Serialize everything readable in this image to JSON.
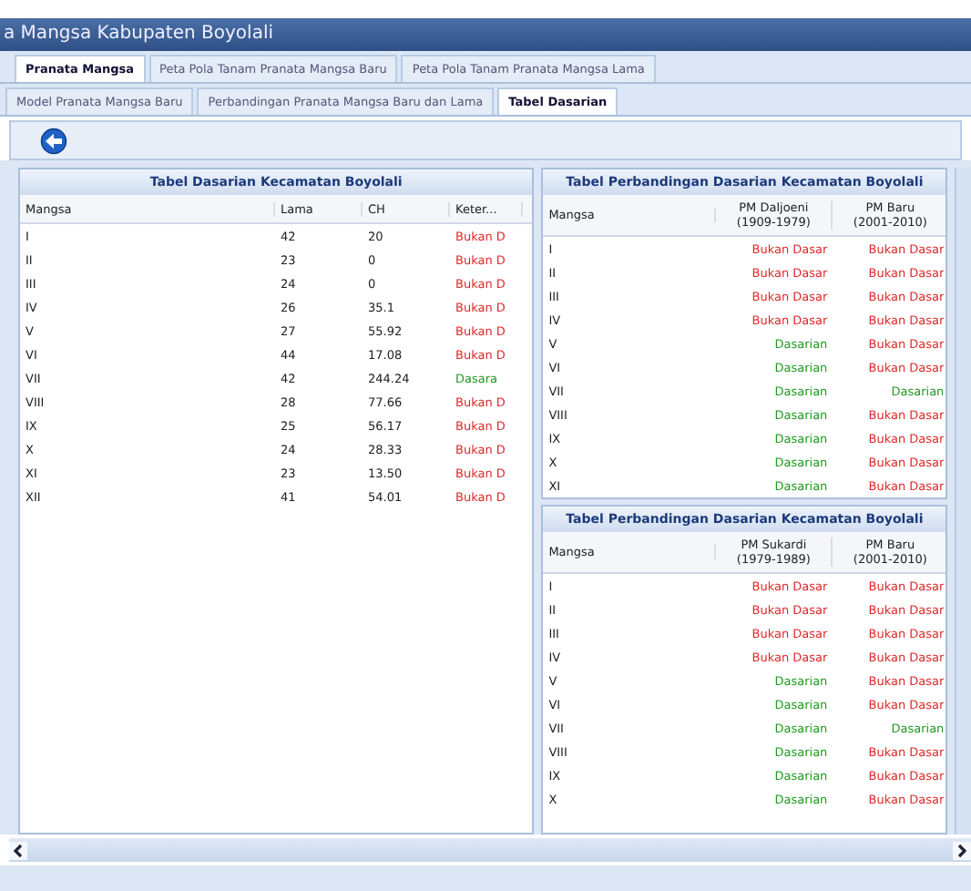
{
  "window": {
    "title": "a Mangsa Kabupaten Boyolali"
  },
  "tabs": [
    {
      "label": "Pranata Mangsa",
      "selected": true
    },
    {
      "label": "Peta Pola Tanam Pranata Mangsa Baru",
      "selected": false
    },
    {
      "label": "Peta Pola Tanam Pranata Mangsa Lama",
      "selected": false
    }
  ],
  "subtabs": [
    {
      "label": "Model Pranata Mangsa Baru",
      "selected": false
    },
    {
      "label": "Perbandingan Pranata Mangsa Baru dan Lama",
      "selected": false
    },
    {
      "label": "Tabel Dasarian",
      "selected": true
    }
  ],
  "left_table": {
    "title": "Tabel Dasarian Kecamatan Boyolali",
    "columns": [
      "Mangsa",
      "Lama",
      "CH",
      "Keter..."
    ],
    "rows": [
      {
        "cells": [
          "I",
          "42",
          "20"
        ],
        "status": {
          "text": "Bukan D",
          "color": "#e02828"
        }
      },
      {
        "cells": [
          "II",
          "23",
          "0"
        ],
        "status": {
          "text": "Bukan D",
          "color": "#e02828"
        }
      },
      {
        "cells": [
          "III",
          "24",
          "0"
        ],
        "status": {
          "text": "Bukan D",
          "color": "#e02828"
        }
      },
      {
        "cells": [
          "IV",
          "26",
          "35.1"
        ],
        "status": {
          "text": "Bukan D",
          "color": "#e02828"
        }
      },
      {
        "cells": [
          "V",
          "27",
          "55.92"
        ],
        "status": {
          "text": "Bukan D",
          "color": "#e02828"
        }
      },
      {
        "cells": [
          "VI",
          "44",
          "17.08"
        ],
        "status": {
          "text": "Bukan D",
          "color": "#e02828"
        }
      },
      {
        "cells": [
          "VII",
          "42",
          "244.24"
        ],
        "status": {
          "text": "Dasara",
          "color": "#229922"
        }
      },
      {
        "cells": [
          "VIII",
          "28",
          "77.66"
        ],
        "status": {
          "text": "Bukan D",
          "color": "#e02828"
        }
      },
      {
        "cells": [
          "IX",
          "25",
          "56.17"
        ],
        "status": {
          "text": "Bukan D",
          "color": "#e02828"
        }
      },
      {
        "cells": [
          "X",
          "24",
          "28.33"
        ],
        "status": {
          "text": "Bukan D",
          "color": "#e02828"
        }
      },
      {
        "cells": [
          "XI",
          "23",
          "13.50"
        ],
        "status": {
          "text": "Bukan D",
          "color": "#e02828"
        }
      },
      {
        "cells": [
          "XII",
          "41",
          "54.01"
        ],
        "status": {
          "text": "Bukan D",
          "color": "#e02828"
        }
      }
    ]
  },
  "compare_tables": [
    {
      "title": "Tabel Perbandingan Dasarian Kecamatan Boyolali",
      "columns": [
        "Mangsa",
        "PM Daljoeni (1909-1979)",
        "PM Baru (2001-2010)"
      ],
      "rows": [
        {
          "mangsa": "I",
          "values": [
            {
              "text": "Bukan Dasar",
              "color": "#e02828"
            },
            {
              "text": "Bukan Dasar",
              "color": "#e02828"
            }
          ]
        },
        {
          "mangsa": "II",
          "values": [
            {
              "text": "Bukan Dasar",
              "color": "#e02828"
            },
            {
              "text": "Bukan Dasar",
              "color": "#e02828"
            }
          ]
        },
        {
          "mangsa": "III",
          "values": [
            {
              "text": "Bukan Dasar",
              "color": "#e02828"
            },
            {
              "text": "Bukan Dasar",
              "color": "#e02828"
            }
          ]
        },
        {
          "mangsa": "IV",
          "values": [
            {
              "text": "Bukan Dasar",
              "color": "#e02828"
            },
            {
              "text": "Bukan Dasar",
              "color": "#e02828"
            }
          ]
        },
        {
          "mangsa": "V",
          "values": [
            {
              "text": "Dasarian",
              "color": "#229922"
            },
            {
              "text": "Bukan Dasar",
              "color": "#e02828"
            }
          ]
        },
        {
          "mangsa": "VI",
          "values": [
            {
              "text": "Dasarian",
              "color": "#229922"
            },
            {
              "text": "Bukan Dasar",
              "color": "#e02828"
            }
          ]
        },
        {
          "mangsa": "VII",
          "values": [
            {
              "text": "Dasarian",
              "color": "#229922"
            },
            {
              "text": "Dasarian",
              "color": "#229922"
            }
          ]
        },
        {
          "mangsa": "VIII",
          "values": [
            {
              "text": "Dasarian",
              "color": "#229922"
            },
            {
              "text": "Bukan Dasar",
              "color": "#e02828"
            }
          ]
        },
        {
          "mangsa": "IX",
          "values": [
            {
              "text": "Dasarian",
              "color": "#229922"
            },
            {
              "text": "Bukan Dasar",
              "color": "#e02828"
            }
          ]
        },
        {
          "mangsa": "X",
          "values": [
            {
              "text": "Dasarian",
              "color": "#229922"
            },
            {
              "text": "Bukan Dasar",
              "color": "#e02828"
            }
          ]
        },
        {
          "mangsa": "XI",
          "values": [
            {
              "text": "Dasarian",
              "color": "#229922"
            },
            {
              "text": "Bukan Dasar",
              "color": "#e02828"
            }
          ]
        }
      ]
    },
    {
      "title": "Tabel Perbandingan Dasarian Kecamatan Boyolali",
      "columns": [
        "Mangsa",
        "PM Sukardi (1979-1989)",
        "PM Baru (2001-2010)"
      ],
      "rows": [
        {
          "mangsa": "I",
          "values": [
            {
              "text": "Bukan Dasar",
              "color": "#e02828"
            },
            {
              "text": "Bukan Dasar",
              "color": "#e02828"
            }
          ]
        },
        {
          "mangsa": "II",
          "values": [
            {
              "text": "Bukan Dasar",
              "color": "#e02828"
            },
            {
              "text": "Bukan Dasar",
              "color": "#e02828"
            }
          ]
        },
        {
          "mangsa": "III",
          "values": [
            {
              "text": "Bukan Dasar",
              "color": "#e02828"
            },
            {
              "text": "Bukan Dasar",
              "color": "#e02828"
            }
          ]
        },
        {
          "mangsa": "IV",
          "values": [
            {
              "text": "Bukan Dasar",
              "color": "#e02828"
            },
            {
              "text": "Bukan Dasar",
              "color": "#e02828"
            }
          ]
        },
        {
          "mangsa": "V",
          "values": [
            {
              "text": "Dasarian",
              "color": "#229922"
            },
            {
              "text": "Bukan Dasar",
              "color": "#e02828"
            }
          ]
        },
        {
          "mangsa": "VI",
          "values": [
            {
              "text": "Dasarian",
              "color": "#229922"
            },
            {
              "text": "Bukan Dasar",
              "color": "#e02828"
            }
          ]
        },
        {
          "mangsa": "VII",
          "values": [
            {
              "text": "Dasarian",
              "color": "#229922"
            },
            {
              "text": "Dasarian",
              "color": "#229922"
            }
          ]
        },
        {
          "mangsa": "VIII",
          "values": [
            {
              "text": "Dasarian",
              "color": "#229922"
            },
            {
              "text": "Bukan Dasar",
              "color": "#e02828"
            }
          ]
        },
        {
          "mangsa": "IX",
          "values": [
            {
              "text": "Dasarian",
              "color": "#229922"
            },
            {
              "text": "Bukan Dasar",
              "color": "#e02828"
            }
          ]
        },
        {
          "mangsa": "X",
          "values": [
            {
              "text": "Dasarian",
              "color": "#229922"
            },
            {
              "text": "Bukan Dasar",
              "color": "#e02828"
            }
          ]
        }
      ]
    }
  ]
}
